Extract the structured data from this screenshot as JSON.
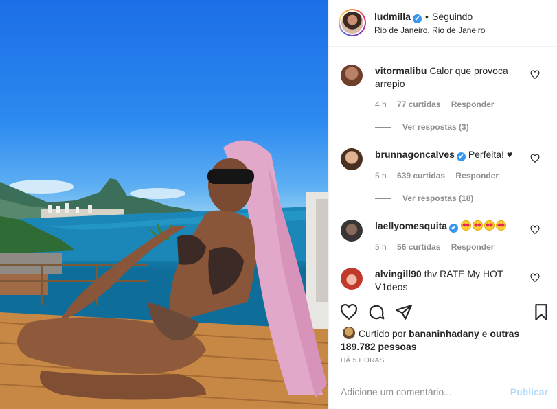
{
  "post": {
    "photo_alt": "photo"
  },
  "header": {
    "username": "ludmilla",
    "verified": "✔",
    "dot": "•",
    "follow_status": "Seguindo",
    "location": "Rio de Janeiro, Rio de Janeiro"
  },
  "comments": [
    {
      "username": "vitormalibu",
      "verified": false,
      "text": "Calor que provoca arrepio",
      "time": "4 h",
      "likes": "77 curtidas",
      "reply": "Responder",
      "view_replies": "Ver respostas (3)"
    },
    {
      "username": "brunnagoncalves",
      "verified": true,
      "text": "Perfeita! ♥",
      "time": "5 h",
      "likes": "639 curtidas",
      "reply": "Responder",
      "view_replies": "Ver respostas (18)"
    },
    {
      "username": "laellyomesquita",
      "verified": true,
      "text": "",
      "emoji_count": 4,
      "emoji_icon": "star-struck-emoji",
      "time": "5 h",
      "likes": "56 curtidas",
      "reply": "Responder"
    },
    {
      "username": "alvingill90",
      "verified": false,
      "text": "thv RATE My HOT V1deos"
    }
  ],
  "actions": {
    "like_icon": "heart-icon",
    "comment_icon": "comment-icon",
    "share_icon": "paper-plane-icon",
    "save_icon": "bookmark-icon"
  },
  "likes_summary": {
    "prefix": "Curtido por",
    "user": "bananinhadany",
    "connector": "e",
    "others": "outras 189.782 pessoas"
  },
  "timestamp": "HÁ 5 HORAS",
  "add_comment": {
    "placeholder": "Adicione um comentário...",
    "publish": "Publicar"
  },
  "colors": {
    "verified_blue": "#3897f0",
    "publish_disabled": "#b3dbff",
    "muted_text": "#8e8e8e"
  }
}
